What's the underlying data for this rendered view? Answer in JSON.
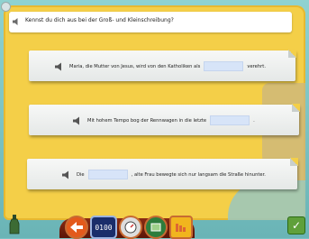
{
  "instruction": {
    "text": "Kennst du dich aus bei der Groß- und Kleinschreibung?"
  },
  "cards": [
    {
      "before": "Maria, die Mutter von Jesus, wird von den Katholiken als",
      "after": "verehrt."
    },
    {
      "before": "Mit hohem Tempo bog der Rennwagen in die letzte",
      "after": "."
    },
    {
      "before": "Die",
      "after": ", alte Frau bewegte sich nur langsam die Straße hinunter."
    }
  ],
  "toolbar": {
    "clock_label": "0100"
  },
  "colors": {
    "board": "#f4cf48",
    "blank": "#d7e4f8",
    "toolbar": "#8a2a12",
    "check": "#5fa03a"
  },
  "icons": [
    "speaker-icon",
    "arrow-icon",
    "clock-icon",
    "gauge-icon",
    "map-icon",
    "folder-icon",
    "check-icon",
    "bottle-icon"
  ]
}
